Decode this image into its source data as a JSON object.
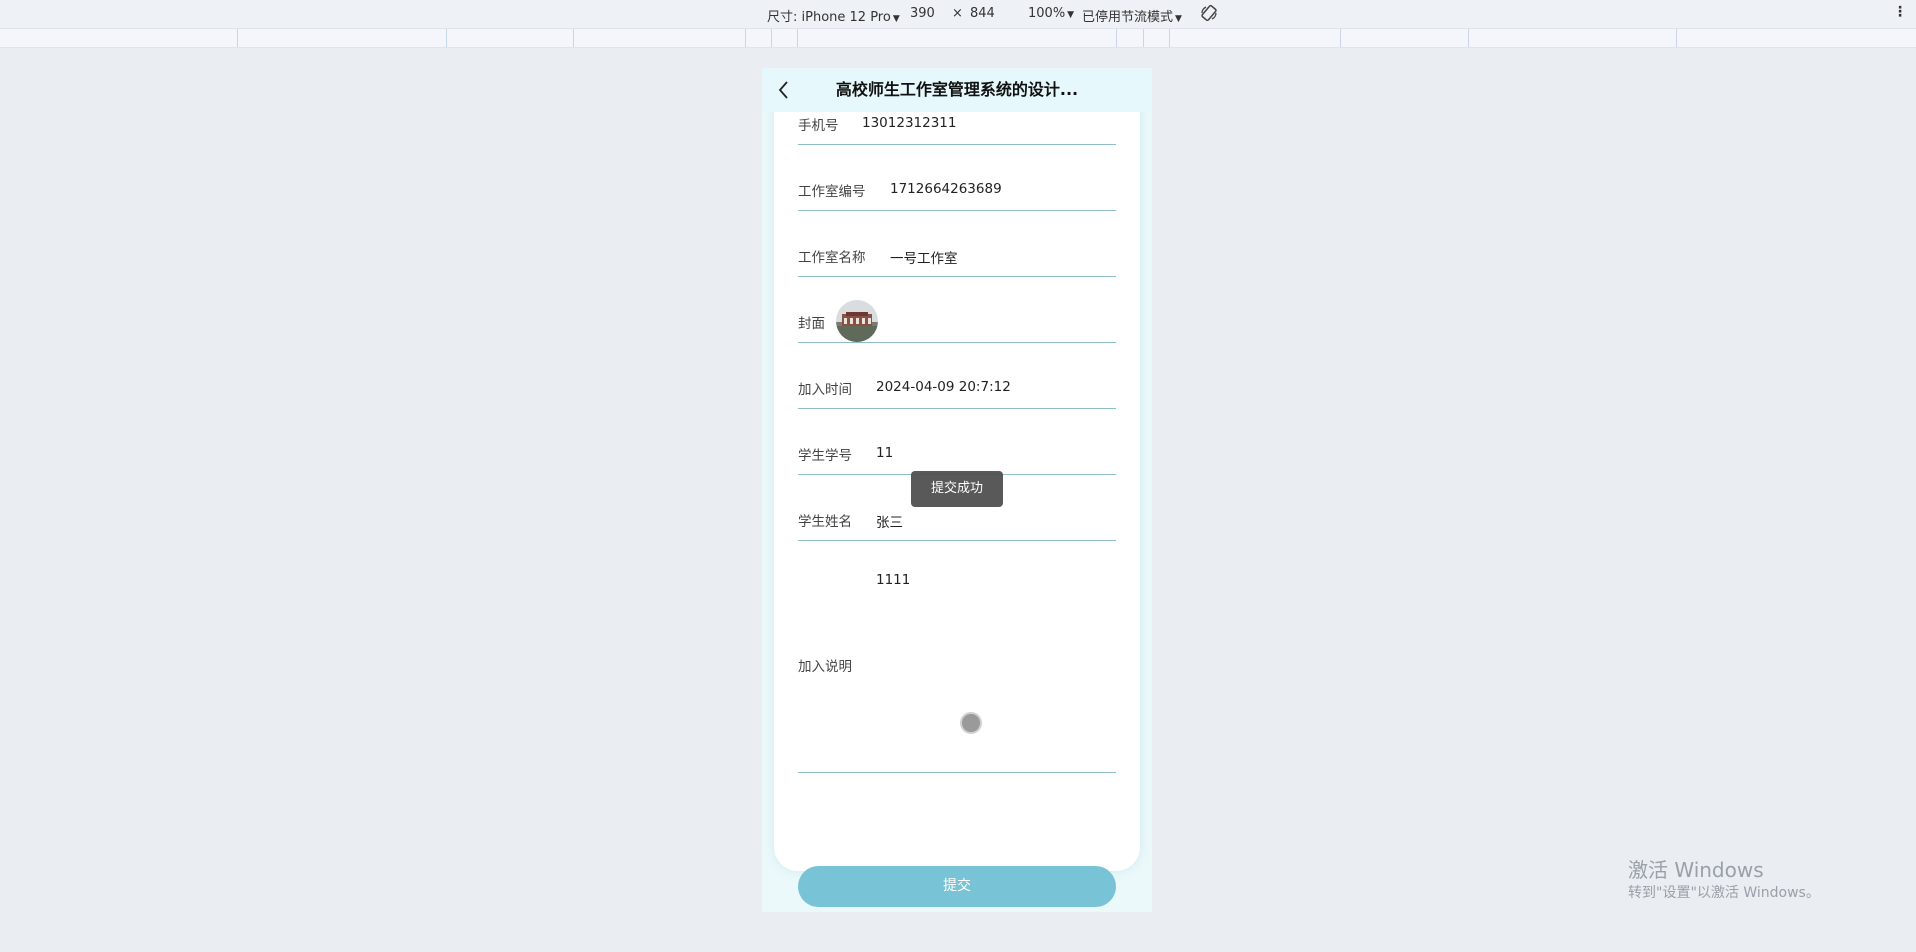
{
  "devtools": {
    "size_label": "尺寸: iPhone 12 Pro",
    "width": "390",
    "times": "×",
    "height": "844",
    "zoom": "100%",
    "throttle": "已停用节流模式"
  },
  "navbar": {
    "title": "高校师生工作室管理系统的设计..."
  },
  "form": {
    "phone": {
      "label": "手机号",
      "value": "13012312311"
    },
    "studio_id": {
      "label": "工作室编号",
      "value": "1712664263689"
    },
    "studio_name": {
      "label": "工作室名称",
      "value": "一号工作室"
    },
    "cover": {
      "label": "封面"
    },
    "join_time": {
      "label": "加入时间",
      "value": "2024-04-09 20:7:12"
    },
    "student_no": {
      "label": "学生学号",
      "value": "11"
    },
    "student_name": {
      "label": "学生姓名",
      "value": "张三"
    },
    "join_desc": {
      "label": "加入说明",
      "value": "1111"
    }
  },
  "submit_label": "提交",
  "toast": "提交成功",
  "watermark": {
    "line1": "激活 Windows",
    "line2": "转到\"设置\"以激活 Windows。"
  }
}
